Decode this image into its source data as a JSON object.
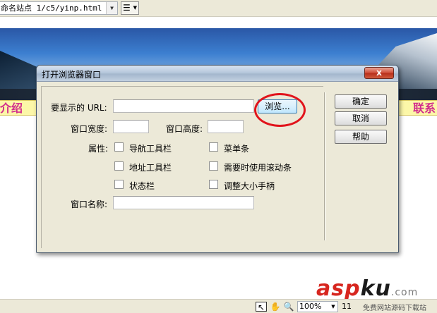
{
  "toolbar": {
    "address_value": "命名站点 1/c5/yinp.html",
    "dropdown_glyph": "▼",
    "list_button_glyph": "☰",
    "list_caret": "▼"
  },
  "page": {
    "nav_left_text": "介绍",
    "nav_right_text": "联系"
  },
  "dialog": {
    "title": "打开浏览器窗口",
    "close_glyph": "x",
    "url_label": "要显示的 URL:",
    "url_value": "",
    "browse_label": "浏览...",
    "width_label": "窗口宽度:",
    "width_value": "",
    "height_label": "窗口高度:",
    "height_value": "",
    "attrs_label": "属性:",
    "checkboxes": [
      {
        "label": "导航工具栏",
        "checked": false
      },
      {
        "label": "菜单条",
        "checked": false
      },
      {
        "label": "地址工具栏",
        "checked": false
      },
      {
        "label": "需要时使用滚动条",
        "checked": false
      },
      {
        "label": "状态栏",
        "checked": false
      },
      {
        "label": "调整大小手柄",
        "checked": false
      }
    ],
    "name_label": "窗口名称:",
    "name_value": "",
    "ok_label": "确定",
    "cancel_label": "取消",
    "help_label": "帮助"
  },
  "statusbar": {
    "pointer_glyph": "↖",
    "hand_glyph": "✋",
    "zoom_tool_glyph": "🔍",
    "zoom_value": "100%",
    "zoom_dropdown_glyph": "▼",
    "size_text": "11"
  },
  "watermark": {
    "brand_red": "asp",
    "brand_dark": "ku",
    "suffix": ".com",
    "sub": "免费网站源码下载站"
  },
  "colors": {
    "highlight_ring": "#e1141c",
    "nav_text": "#d12c8c",
    "nav_bg": "#fcf7a8",
    "dialog_bg": "#ece9d8"
  }
}
